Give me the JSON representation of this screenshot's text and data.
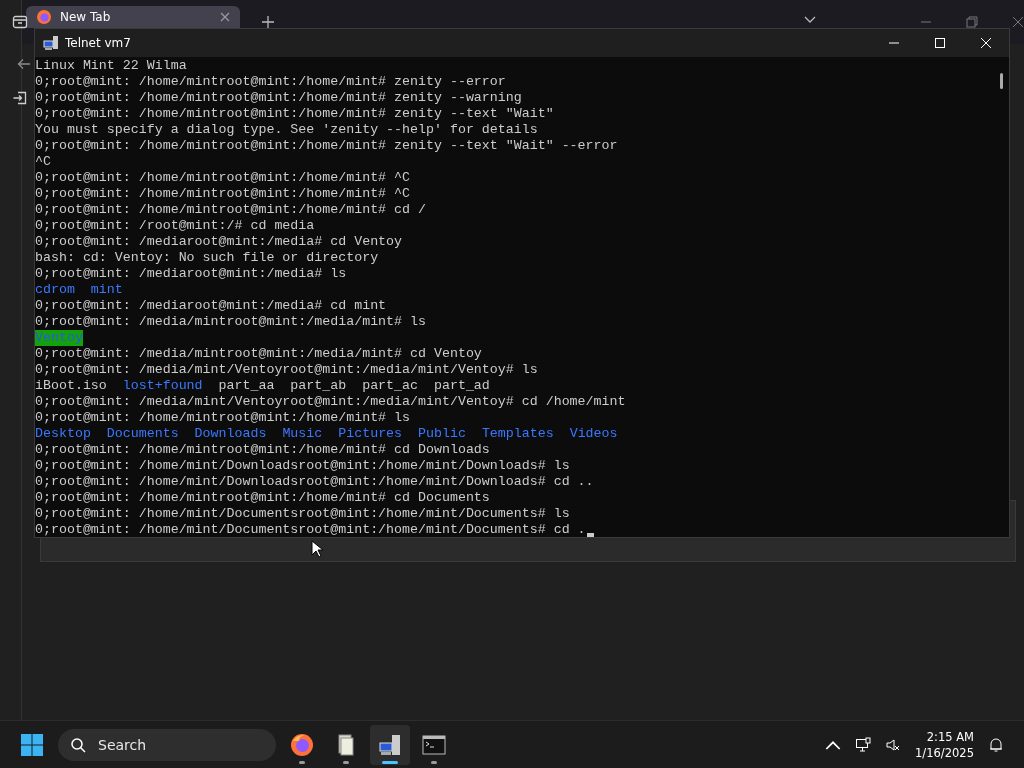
{
  "browser": {
    "tabs": [
      {
        "label": "New Tab",
        "selected": true
      }
    ]
  },
  "telnet_window": {
    "title": "Telnet vm7"
  },
  "terminal": {
    "cursor_visible": true,
    "lines": [
      {
        "kind": "text",
        "text": "Linux Mint 22 Wilma"
      },
      {
        "kind": "text",
        "text": "0;root@mint: /home/mintroot@mint:/home/mint# zenity --error"
      },
      {
        "kind": "text",
        "text": "0;root@mint: /home/mintroot@mint:/home/mint# zenity --warning"
      },
      {
        "kind": "text",
        "text": "0;root@mint: /home/mintroot@mint:/home/mint# zenity --text \"Wait\""
      },
      {
        "kind": "text",
        "text": "You must specify a dialog type. See 'zenity --help' for details"
      },
      {
        "kind": "text",
        "text": "0;root@mint: /home/mintroot@mint:/home/mint# zenity --text \"Wait\" --error"
      },
      {
        "kind": "text",
        "text": "^C"
      },
      {
        "kind": "text",
        "text": "0;root@mint: /home/mintroot@mint:/home/mint# ^C"
      },
      {
        "kind": "text",
        "text": "0;root@mint: /home/mintroot@mint:/home/mint# ^C"
      },
      {
        "kind": "text",
        "text": "0;root@mint: /home/mintroot@mint:/home/mint# cd /"
      },
      {
        "kind": "text",
        "text": "0;root@mint: /root@mint:/# cd media"
      },
      {
        "kind": "text",
        "text": "0;root@mint: /mediaroot@mint:/media# cd Ventoy"
      },
      {
        "kind": "text",
        "text": "bash: cd: Ventoy: No such file or directory"
      },
      {
        "kind": "text",
        "text": "0;root@mint: /mediaroot@mint:/media# ls"
      },
      {
        "kind": "listing",
        "entries": [
          {
            "name": "cdrom",
            "kind": "dir"
          },
          {
            "name": "mint",
            "kind": "dir"
          }
        ]
      },
      {
        "kind": "text",
        "text": "0;root@mint: /mediaroot@mint:/media# cd mint"
      },
      {
        "kind": "text",
        "text": "0;root@mint: /media/mintroot@mint:/media/mint# ls"
      },
      {
        "kind": "listing",
        "entries": [
          {
            "name": "Ventoy",
            "kind": "highlighted"
          }
        ]
      },
      {
        "kind": "text",
        "text": "0;root@mint: /media/mintroot@mint:/media/mint# cd Ventoy"
      },
      {
        "kind": "text",
        "text": "0;root@mint: /media/mint/Ventoyroot@mint:/media/mint/Ventoy# ls"
      },
      {
        "kind": "listing",
        "entries": [
          {
            "name": "iBoot.iso",
            "kind": "file"
          },
          {
            "name": "lost+found",
            "kind": "dir"
          },
          {
            "name": "part_aa",
            "kind": "file"
          },
          {
            "name": "part_ab",
            "kind": "file"
          },
          {
            "name": "part_ac",
            "kind": "file"
          },
          {
            "name": "part_ad",
            "kind": "file"
          }
        ]
      },
      {
        "kind": "text",
        "text": "0;root@mint: /media/mint/Ventoyroot@mint:/media/mint/Ventoy# cd /home/mint"
      },
      {
        "kind": "text",
        "text": "0;root@mint: /home/mintroot@mint:/home/mint# ls"
      },
      {
        "kind": "listing",
        "entries": [
          {
            "name": "Desktop",
            "kind": "dir"
          },
          {
            "name": "Documents",
            "kind": "dir"
          },
          {
            "name": "Downloads",
            "kind": "dir"
          },
          {
            "name": "Music",
            "kind": "dir"
          },
          {
            "name": "Pictures",
            "kind": "dir"
          },
          {
            "name": "Public",
            "kind": "dir"
          },
          {
            "name": "Templates",
            "kind": "dir"
          },
          {
            "name": "Videos",
            "kind": "dir"
          }
        ]
      },
      {
        "kind": "text",
        "text": "0;root@mint: /home/mintroot@mint:/home/mint# cd Downloads"
      },
      {
        "kind": "text",
        "text": "0;root@mint: /home/mint/Downloadsroot@mint:/home/mint/Downloads# ls"
      },
      {
        "kind": "text",
        "text": "0;root@mint: /home/mint/Downloadsroot@mint:/home/mint/Downloads# cd .."
      },
      {
        "kind": "text",
        "text": "0;root@mint: /home/mintroot@mint:/home/mint# cd Documents"
      },
      {
        "kind": "text",
        "text": "0;root@mint: /home/mint/Documentsroot@mint:/home/mint/Documents# ls"
      },
      {
        "kind": "text",
        "text": "0;root@mint: /home/mint/Documentsroot@mint:/home/mint/Documents# cd ."
      }
    ]
  },
  "taskbar": {
    "search": {
      "placeholder": "Search"
    },
    "apps": [
      {
        "kind": "firefox",
        "selected": false
      },
      {
        "kind": "files",
        "selected": false
      },
      {
        "kind": "telnet",
        "selected": true
      },
      {
        "kind": "console",
        "selected": false
      }
    ],
    "clock": {
      "time": "2:15 AM",
      "date": "1/16/2025"
    }
  }
}
